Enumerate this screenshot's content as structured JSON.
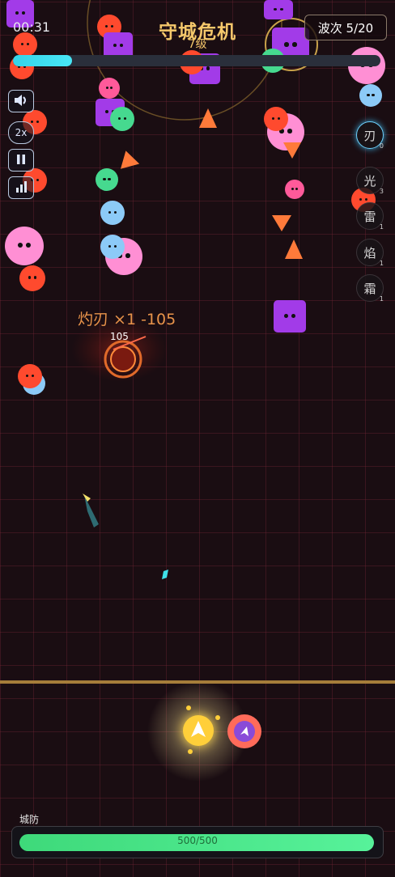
{
  "hud": {
    "timer": "00:31",
    "title": "守城危机",
    "level": "7级",
    "wave": "波次 5/20",
    "xp_progress": 0.16
  },
  "controls": {
    "speed_label": "2x"
  },
  "skills": [
    {
      "name": "刃",
      "count": "0",
      "active": true
    },
    {
      "name": "光",
      "count": "3",
      "active": false
    },
    {
      "name": "雷",
      "count": "1",
      "active": false
    },
    {
      "name": "焰",
      "count": "1",
      "active": false
    },
    {
      "name": "霜",
      "count": "1",
      "active": false
    }
  ],
  "combat": {
    "hit_text": "灼刃 ×1 -105",
    "damage_number": "105"
  },
  "city": {
    "label": "城防",
    "hp_text": "500/500",
    "hp_fraction": 1.0
  },
  "colors": {
    "gold": "#f5c86b",
    "xp": "#35d3e8",
    "hp": "#3ed97a",
    "enemy_red": "#ff4a2e",
    "enemy_pink": "#ff8fd4",
    "enemy_blue": "#8ccaf7",
    "enemy_green": "#46d98f",
    "enemy_purple": "#a23be8",
    "enemy_orange": "#ff7a3a"
  },
  "icons": [
    "speaker-icon",
    "pause-icon",
    "stats-icon",
    "arrow-up-icon"
  ]
}
